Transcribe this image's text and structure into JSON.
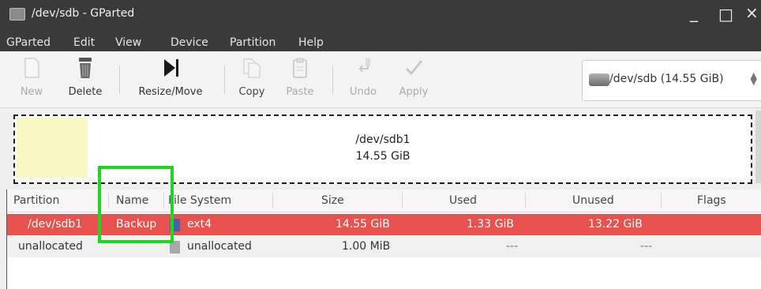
{
  "window": {
    "title": "/dev/sdb - GParted",
    "minimize": "_",
    "maximize": "□",
    "close": "×"
  },
  "menu": [
    "GParted",
    "Edit",
    "View",
    "Device",
    "Partition",
    "Help"
  ],
  "toolbar": {
    "new": "New",
    "delete": "Delete",
    "resize": "Resize/Move",
    "copy": "Copy",
    "paste": "Paste",
    "undo": "Undo",
    "apply": "Apply"
  },
  "device": {
    "label": "/dev/sdb  (14.55 GiB)"
  },
  "map": {
    "partition_name": "/dev/sdb1",
    "partition_size": "14.55 GiB"
  },
  "columns": [
    "Partition",
    "Name",
    "File System",
    "Size",
    "Used",
    "Unused",
    "Flags"
  ],
  "rows": [
    {
      "partition": "/dev/sdb1",
      "name": "Backup",
      "fs": "ext4",
      "fs_color": "#4b5fa8",
      "size": "14.55 GiB",
      "used": "1.33 GiB",
      "unused": "13.22 GiB",
      "flags": ""
    },
    {
      "partition": "unallocated",
      "name": "",
      "fs": "unallocated",
      "fs_color": "#a8a8a8",
      "size": "1.00 MiB",
      "used": "---",
      "unused": "---",
      "flags": ""
    }
  ],
  "colors": {
    "selected_row": "#e8524e",
    "highlight": "#23d423",
    "used_space": "#faf8c2"
  }
}
